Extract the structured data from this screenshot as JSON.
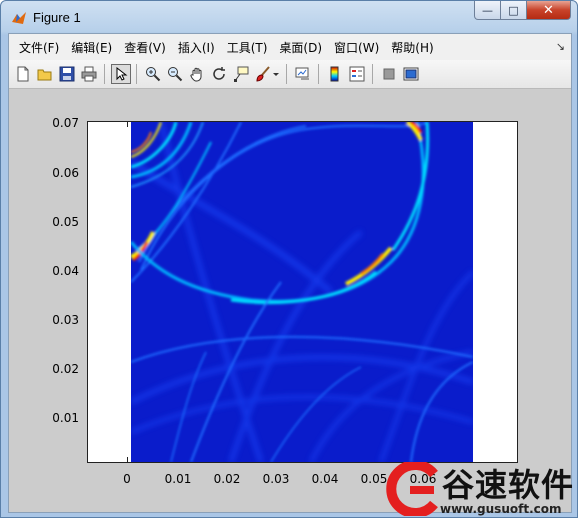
{
  "window": {
    "title": "Figure 1",
    "buttons": {
      "minimize": "—",
      "maximize": "□",
      "close": "✕"
    }
  },
  "menu": {
    "items": [
      "文件(F)",
      "编辑(E)",
      "查看(V)",
      "插入(I)",
      "工具(T)",
      "桌面(D)",
      "窗口(W)",
      "帮助(H)"
    ],
    "overflow_icon": "double-chevron-icon"
  },
  "toolbar": {
    "icons": [
      "new-figure-icon",
      "open-file-icon",
      "save-icon",
      "print-icon",
      "edit-plot-arrow-icon",
      "zoom-in-icon",
      "zoom-out-icon",
      "pan-hand-icon",
      "rotate-3d-icon",
      "data-cursor-icon",
      "brush-icon",
      "brush-dropdown-icon",
      "link-plot-icon",
      "colorbar-icon",
      "legend-icon",
      "hide-plot-tools-icon",
      "show-plot-tools-icon"
    ]
  },
  "chart_data": {
    "type": "heatmap",
    "title": "",
    "xlabel": "",
    "ylabel": "",
    "x_ticks": [
      "0",
      "0.01",
      "0.02",
      "0.03",
      "0.04",
      "0.05",
      "0.06"
    ],
    "y_ticks": [
      "0.01",
      "0.02",
      "0.03",
      "0.04",
      "0.05",
      "0.06",
      "0.07"
    ],
    "xlim": [
      -0.0075,
      0.0795
    ],
    "ylim": [
      0.0,
      0.0705
    ],
    "image_extent_x": [
      0.001,
      0.07
    ],
    "image_extent_y": [
      0.0,
      0.0705
    ],
    "colormap": "jet",
    "features": [
      {
        "kind": "arc",
        "label": "large circular arc",
        "peak_value": "high",
        "peak_location": [
          0.0,
          0.042
        ]
      },
      {
        "kind": "arc",
        "label": "upper-right arc",
        "peak_value": "high",
        "peak_location": [
          0.058,
          0.07
        ]
      },
      {
        "kind": "arc",
        "label": "bright arc segment",
        "peak_value": "medium-high",
        "peak_location": [
          0.05,
          0.043
        ]
      }
    ],
    "colors": {
      "background_low": "#0a1ccb",
      "mid": "#1e6bff",
      "high": "#ffef00",
      "peak": "#ff1400"
    },
    "grid": false
  },
  "watermark": {
    "brand": "谷速软件",
    "url": "www.gusuoft.com"
  }
}
